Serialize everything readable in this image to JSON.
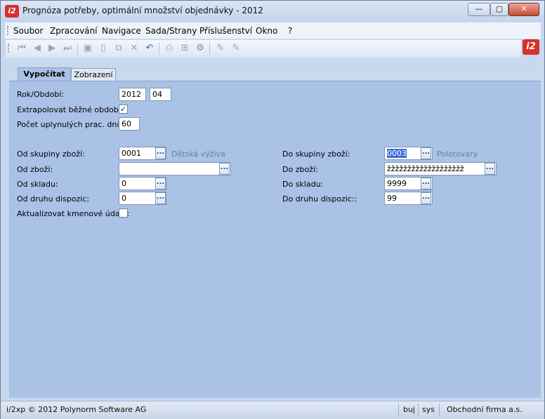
{
  "window": {
    "title": "Prognóza potřeby, optimální množství objednávky - 2012",
    "logo_text": "i2",
    "minimize_label": "—",
    "maximize_label": "▢",
    "close_label": "✕"
  },
  "menu": {
    "items": [
      "Soubor",
      "Zpracování",
      "Navigace",
      "Sada/Strany",
      "Příslušenství",
      "Okno",
      "?"
    ]
  },
  "toolbar": {
    "icons": [
      "first-record-icon",
      "prev-record-icon",
      "next-record-icon",
      "last-record-icon",
      "save-icon",
      "new-document-icon",
      "copy-icon",
      "delete-icon",
      "undo-icon",
      "print-icon",
      "tree-icon",
      "settings-gear-icon",
      "edit-pen-icon",
      "edit-pen-disabled-icon"
    ],
    "brand_text": "i2"
  },
  "tabs": [
    {
      "label": "Vypočítat",
      "active": true
    },
    {
      "label": "Zobrazení",
      "active": false
    }
  ],
  "form": {
    "rok_label": "Rok/Období:",
    "rok_value": "2012",
    "obdobi_value": "04",
    "extrapolate_label": "Extrapolovat běžné období:",
    "extrapolate_checked": true,
    "pocet_label": "Počet uplynulých prac. dnů:",
    "pocet_value": "60",
    "od_skupiny_label": "Od skupiny zboží:",
    "od_skupiny_value": "0001",
    "od_skupiny_hint": "Dětská výživa",
    "do_skupiny_label": "Do skupiny zboží:",
    "do_skupiny_value": "0003",
    "do_skupiny_hint": "Polotovary",
    "od_zbozi_label": "Od zboží:",
    "od_zbozi_value": "",
    "do_zbozi_label": "Do zboží:",
    "do_zbozi_value": "žžžžžžžžžžžžžžžžžžž",
    "od_skladu_label": "Od skladu:",
    "od_skladu_value": "0",
    "do_skladu_label": "Do skladu:",
    "do_skladu_value": "9999",
    "od_druhu_label": "Od druhu dispozic:",
    "od_druhu_value": "0",
    "do_druhu_label": "Do druhu dispozic::",
    "do_druhu_value": "99",
    "aktualizovat_label": "Aktualizovat kmenové údaje:",
    "aktualizovat_checked": false,
    "browse_label": "..."
  },
  "status": {
    "copyright": "i/2xp © 2012 Polynorm Software AG",
    "user": "buj",
    "system": "sys",
    "company": "Obchodní firma a.s."
  },
  "colors": {
    "panel_bg": "#a9c2e6",
    "selection": "#3a6fd8",
    "logo_red": "#d8302a"
  }
}
